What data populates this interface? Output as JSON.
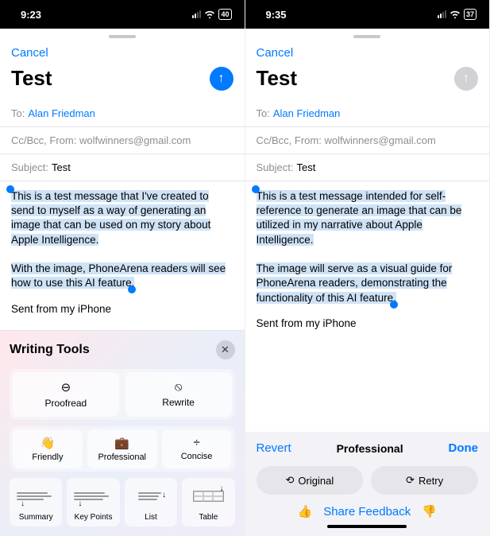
{
  "left": {
    "status_time": "9:23",
    "battery": "40",
    "cancel": "Cancel",
    "title": "Test",
    "to_label": "To:",
    "to_value": "Alan Friedman",
    "ccbcc": "Cc/Bcc, From: wolfwinners@gmail.com",
    "subject_label": "Subject:",
    "subject_value": "Test",
    "body_p1": "This is a test message that I've created to send to myself as a way of generating an image that can be used on my story about Apple Intelligence.",
    "body_p2": "With the image, PhoneArena readers will see how to use this AI feature.",
    "signature": "Sent from my iPhone",
    "wt": {
      "title": "Writing Tools",
      "proofread": "Proofread",
      "rewrite": "Rewrite",
      "friendly": "Friendly",
      "professional": "Professional",
      "concise": "Concise",
      "summary": "Summary",
      "keypoints": "Key Points",
      "list": "List",
      "table": "Table"
    }
  },
  "right": {
    "status_time": "9:35",
    "battery": "37",
    "cancel": "Cancel",
    "title": "Test",
    "to_label": "To:",
    "to_value": "Alan Friedman",
    "ccbcc": "Cc/Bcc, From: wolfwinners@gmail.com",
    "subject_label": "Subject:",
    "subject_value": "Test",
    "body_p1": "This is a test message intended for self-reference to generate an image that can be utilized in my narrative about Apple Intelligence.",
    "body_p2": "The image will serve as a visual guide for PhoneArena readers, demonstrating the functionality of this AI feature.",
    "signature": "Sent from my iPhone",
    "result": {
      "revert": "Revert",
      "mode": "Professional",
      "done": "Done",
      "original": "Original",
      "retry": "Retry",
      "feedback": "Share Feedback"
    }
  }
}
